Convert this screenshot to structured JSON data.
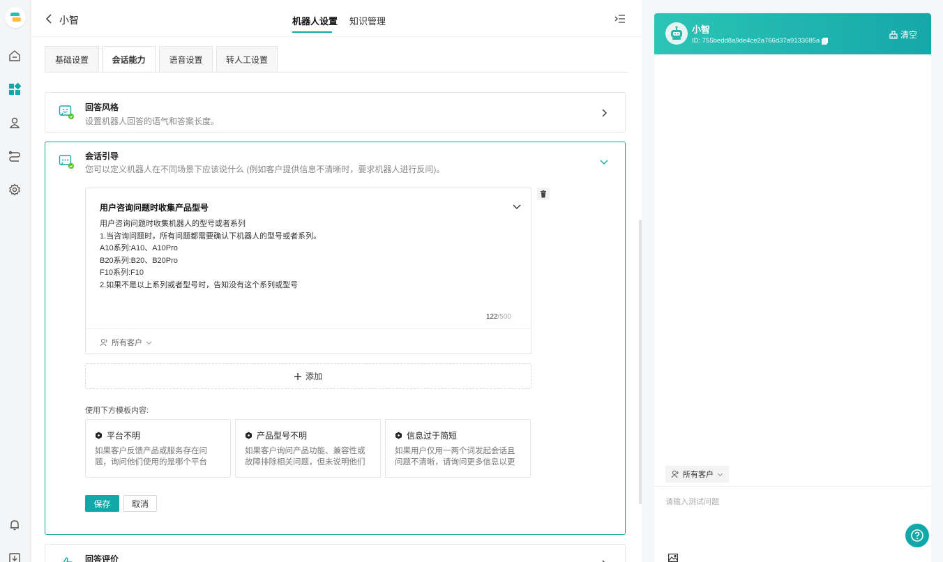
{
  "header": {
    "bot_name": "小智",
    "tabs": [
      "机器人设置",
      "知识管理"
    ]
  },
  "subtabs": [
    "基础设置",
    "会话能力",
    "语音设置",
    "转人工设置"
  ],
  "answer_style": {
    "title": "回答风格",
    "desc": "设置机器人回答的语气和答案长度。"
  },
  "guidance": {
    "title": "会话引导",
    "desc": "您可以定义机器人在不同场景下应该说什么 (例如客户提供信息不清晰时，要求机器人进行反问)。",
    "rule": {
      "title": "用户咨询问题时收集产品型号",
      "lines": [
        "用户咨询问题时收集机器人的型号或者系列",
        "1.当咨询问题时，所有问题都需要确认下机器人的型号或者系列。",
        "A10系列:A10、A10Pro",
        "B20系列:B20、B20Pro",
        "F10系列:F10",
        "2.如果不是以上系列或者型号时，告知没有这个系列或型号"
      ],
      "count": "122",
      "max": "/500",
      "audience": "所有客户"
    },
    "add_label": "添加",
    "template_label": "使用下方模板内容:",
    "templates": [
      {
        "title": "平台不明",
        "desc": "如果客户反馈产品或服务存在问题，询问他们使用的是哪个平台（iOS..."
      },
      {
        "title": "产品型号不明",
        "desc": "如果客户询问产品功能、兼容性或故障排除相关问题，但未说明他们使..."
      },
      {
        "title": "信息过于简短",
        "desc": "如果用户仅用一两个词发起会话且问题不清晰，请询问更多信息以更好..."
      }
    ],
    "save_label": "保存",
    "cancel_label": "取消"
  },
  "answer_eval": {
    "title": "回答评价"
  },
  "preview": {
    "name": "小智",
    "id": "ID: 755bedd8a9de4ce2a766d37a9133685a",
    "clear_label": "清空",
    "audience": "所有客户",
    "input_placeholder": "请输入测试问题"
  },
  "colors": {
    "accent": "#13a8a8",
    "header_gradient_start": "#2cc4b6",
    "success": "#52c41a"
  },
  "icons": {
    "rail": [
      "logo-icon",
      "home-icon",
      "apps-icon",
      "user-location-icon",
      "flow-icon",
      "settings-icon",
      "bell-icon",
      "download-icon"
    ]
  }
}
